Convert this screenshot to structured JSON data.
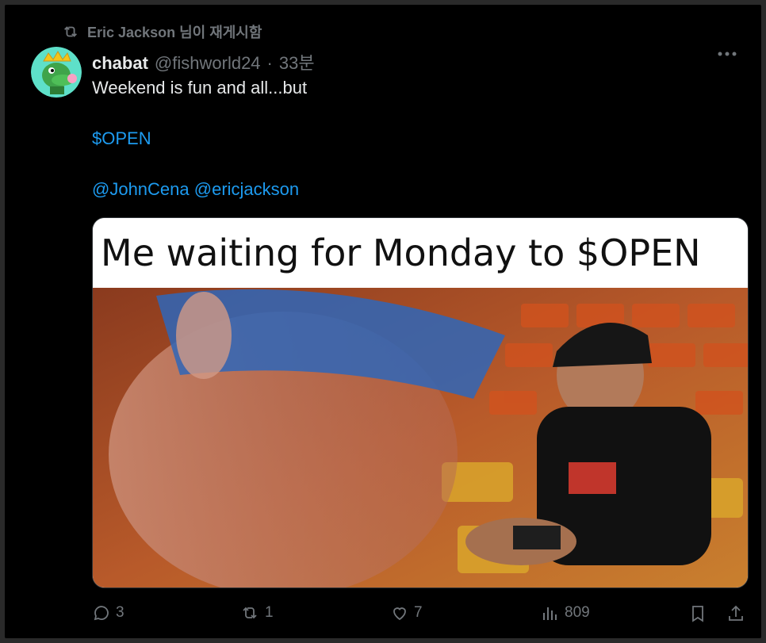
{
  "retweet": {
    "icon": "retweet-icon",
    "text": "Eric Jackson 님이 재게시함"
  },
  "post": {
    "author_name": "chabat",
    "handle": "@fishworld24",
    "separator": "·",
    "time": "33분",
    "text_line1": "Weekend is fun and all...but",
    "cashtag": "$OPEN",
    "mention1": "@JohnCena",
    "mention2": "@ericjackson",
    "more_icon": "more-icon"
  },
  "media": {
    "caption": "Me waiting for Monday to $OPEN",
    "image_description_icon": "meme-photo"
  },
  "actions": {
    "reply_count": "3",
    "repost_count": "1",
    "like_count": "7",
    "views_count": "809"
  },
  "colors": {
    "background": "#000000",
    "text": "#e7e9ea",
    "secondary": "#71767b",
    "link": "#1d9bf0"
  }
}
